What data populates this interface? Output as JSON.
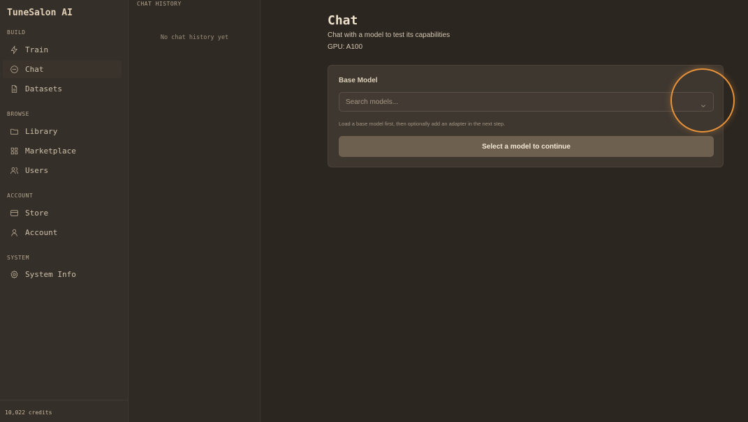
{
  "app": {
    "brand": "TuneSalon AI"
  },
  "sidebar": {
    "sections": {
      "build": "BUILD",
      "browse": "BROWSE",
      "account": "ACCOUNT",
      "system": "SYSTEM"
    },
    "items": {
      "train": {
        "label": "Train",
        "icon": "bolt-icon"
      },
      "chat": {
        "label": "Chat",
        "icon": "chat-bubble-icon"
      },
      "datasets": {
        "label": "Datasets",
        "icon": "file-icon"
      },
      "library": {
        "label": "Library",
        "icon": "folder-icon"
      },
      "marketplace": {
        "label": "Marketplace",
        "icon": "grid-icon"
      },
      "users": {
        "label": "Users",
        "icon": "users-icon"
      },
      "store": {
        "label": "Store",
        "icon": "card-icon"
      },
      "account": {
        "label": "Account",
        "icon": "user-icon"
      },
      "system_info": {
        "label": "System Info",
        "icon": "gear-icon"
      }
    },
    "active": "chat",
    "credits": "10,022 credits"
  },
  "history": {
    "title": "CHAT HISTORY",
    "empty": "No chat history yet"
  },
  "main": {
    "title": "Chat",
    "subtitle": "Chat with a model to test its capabilities",
    "gpu": "GPU: A100",
    "card": {
      "label": "Base Model",
      "placeholder": "Search models...",
      "hint": "Load a base model first, then optionally add an adapter in the next step.",
      "button": "Select a model to continue"
    }
  },
  "colors": {
    "accent_highlight": "#e8923a",
    "background": "#2b2620",
    "sidebar": "#352f29"
  }
}
